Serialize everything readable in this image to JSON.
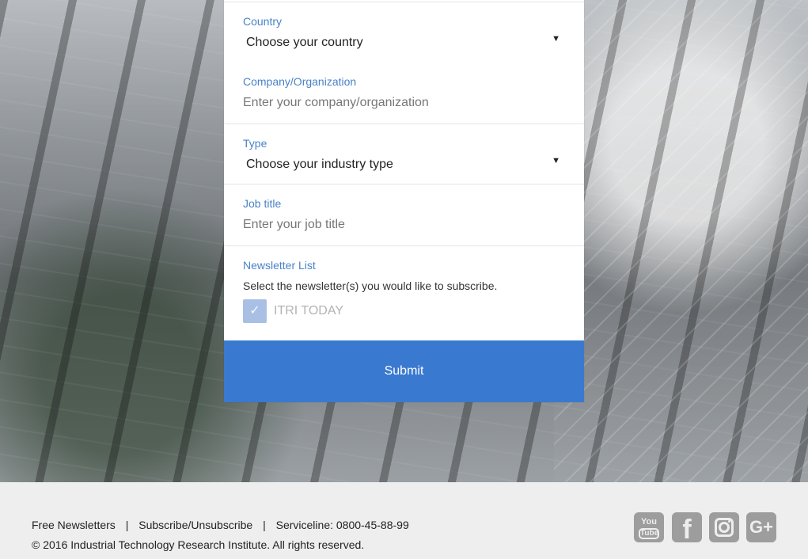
{
  "form": {
    "country": {
      "label": "Country",
      "value": "Choose your country",
      "arrow": "▼"
    },
    "company": {
      "label": "Company/Organization",
      "placeholder": "Enter your company/organization"
    },
    "type": {
      "label": "Type",
      "value": "Choose your industry type",
      "arrow": "▼"
    },
    "job": {
      "label": "Job title",
      "placeholder": "Enter your job title"
    },
    "newsletter": {
      "label": "Newsletter List",
      "description": "Select the newsletter(s) you would like to subscribe.",
      "checkbox_mark": "✓",
      "option": "ITRI TODAY"
    },
    "submit": "Submit"
  },
  "footer": {
    "links": [
      "Free Newsletters",
      "Subscribe/Unsubscribe",
      "Serviceline: 0800-45-88-99"
    ],
    "separator": "|",
    "copyright": "© 2016 Industrial Technology Research Institute. All rights reserved."
  },
  "social": {
    "youtube": {
      "line1": "You",
      "line2": "Tube"
    },
    "facebook": "f",
    "googleplus": "G+",
    "icons": [
      "youtube-icon",
      "facebook-icon",
      "instagram-icon",
      "google-plus-icon"
    ]
  },
  "colors": {
    "accent": "#3a79d0",
    "label": "#4a82c8",
    "footer_background": "#eeeeee",
    "social_icon": "#9d9d9d"
  }
}
